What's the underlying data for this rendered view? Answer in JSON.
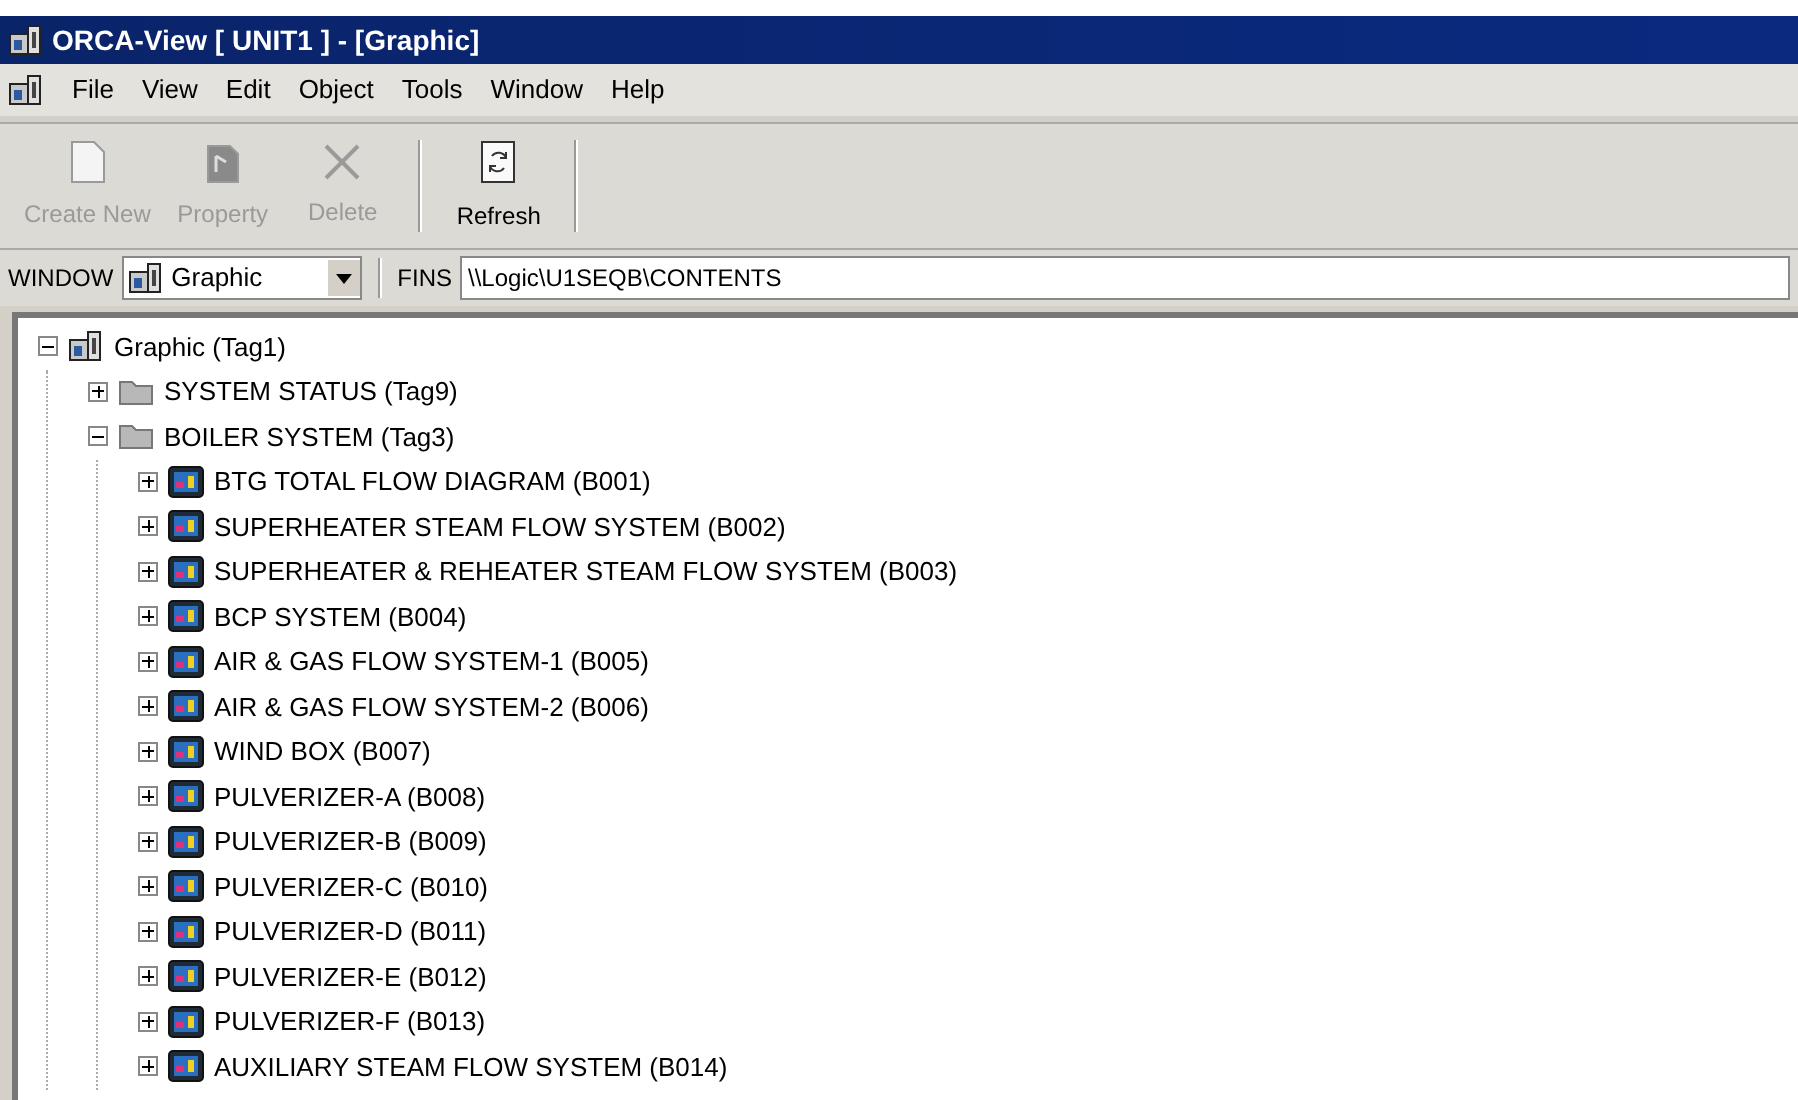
{
  "window": {
    "title": "ORCA-View [ UNIT1 ] - [Graphic]"
  },
  "menu": [
    "File",
    "View",
    "Edit",
    "Object",
    "Tools",
    "Window",
    "Help"
  ],
  "toolbar": [
    {
      "label": "Create New",
      "kind": "new",
      "disabled": true
    },
    {
      "label": "Property",
      "kind": "property",
      "disabled": true
    },
    {
      "label": "Delete",
      "kind": "delete",
      "disabled": true
    },
    {
      "label": "Refresh",
      "kind": "refresh",
      "disabled": false
    }
  ],
  "address_bar": {
    "window_label": "WINDOW",
    "window_value": "Graphic",
    "fins_label": "FINS",
    "fins_value": "\\\\Logic\\U1SEQB\\CONTENTS"
  },
  "tree": [
    {
      "label": "Graphic (Tag1)",
      "kind": "root",
      "expanded": true,
      "children": [
        {
          "label": "SYSTEM STATUS (Tag9)",
          "kind": "folder",
          "expanded": false
        },
        {
          "label": "BOILER SYSTEM (Tag3)",
          "kind": "folder",
          "expanded": true,
          "children": [
            {
              "label": "BTG TOTAL FLOW DIAGRAM (B001)",
              "kind": "graphic",
              "expanded": false
            },
            {
              "label": "SUPERHEATER STEAM FLOW SYSTEM (B002)",
              "kind": "graphic",
              "expanded": false
            },
            {
              "label": "SUPERHEATER & REHEATER STEAM FLOW SYSTEM (B003)",
              "kind": "graphic",
              "expanded": false
            },
            {
              "label": "BCP SYSTEM (B004)",
              "kind": "graphic",
              "expanded": false
            },
            {
              "label": "AIR & GAS FLOW SYSTEM-1 (B005)",
              "kind": "graphic",
              "expanded": false
            },
            {
              "label": "AIR & GAS FLOW SYSTEM-2 (B006)",
              "kind": "graphic",
              "expanded": false
            },
            {
              "label": "WIND BOX (B007)",
              "kind": "graphic",
              "expanded": false
            },
            {
              "label": "PULVERIZER-A (B008)",
              "kind": "graphic",
              "expanded": false
            },
            {
              "label": "PULVERIZER-B (B009)",
              "kind": "graphic",
              "expanded": false
            },
            {
              "label": "PULVERIZER-C (B010)",
              "kind": "graphic",
              "expanded": false
            },
            {
              "label": "PULVERIZER-D (B011)",
              "kind": "graphic",
              "expanded": false
            },
            {
              "label": "PULVERIZER-E (B012)",
              "kind": "graphic",
              "expanded": false
            },
            {
              "label": "PULVERIZER-F (B013)",
              "kind": "graphic",
              "expanded": false
            },
            {
              "label": "AUXILIARY STEAM FLOW SYSTEM (B014)",
              "kind": "graphic",
              "expanded": false
            }
          ]
        }
      ]
    }
  ]
}
